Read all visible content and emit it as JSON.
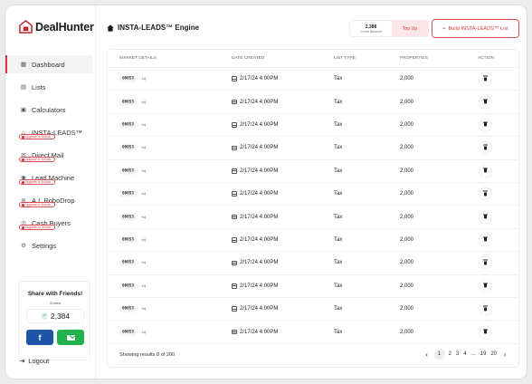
{
  "app": {
    "name": "DealHunter"
  },
  "sidebar": {
    "items": [
      {
        "label": "Dashboard",
        "icon": "grid-icon"
      },
      {
        "label": "Lists",
        "icon": "list-icon"
      },
      {
        "label": "Calculators",
        "icon": "calculator-icon"
      },
      {
        "label": "INSTA-LEADS™",
        "icon": "home-outline-icon",
        "locked": true
      },
      {
        "label": "Direct Mail",
        "icon": "mail-icon",
        "locked": true
      },
      {
        "label": "Lead Machine",
        "icon": "target-icon",
        "locked": true
      },
      {
        "label": "A.I. RoboDrop",
        "icon": "robot-icon",
        "locked": true
      },
      {
        "label": "Cash Buyers",
        "icon": "cash-icon",
        "locked": true
      },
      {
        "label": "Settings",
        "icon": "gear-icon"
      }
    ],
    "lock_badge": "Upgrade to Unlock",
    "logout": "Logout"
  },
  "share": {
    "title": "Share with Friends!",
    "subtitle": "Shares",
    "count": "2,384"
  },
  "header": {
    "title": "INSTA-LEADS™ Engine",
    "credit_value": "2,388",
    "credit_label": "Credit Balance",
    "topup_label": "Top Up",
    "build_label": "Build INSTA-LEADS™ List",
    "build_plus": "+"
  },
  "table": {
    "columns": [
      "MARKET DETAILS",
      "DATE CREATED",
      "LIST TYPE",
      "PROPERTIES",
      "ACTION"
    ],
    "rows": [
      {
        "zip": "06053",
        "more": "+4",
        "date": "2/17/24 4:00PM",
        "type": "Tax",
        "properties": "2,000"
      },
      {
        "zip": "06053",
        "more": "+4",
        "date": "2/17/24 4:00PM",
        "type": "Tax",
        "properties": "2,000"
      },
      {
        "zip": "06053",
        "more": "+4",
        "date": "2/17/24 4:00PM",
        "type": "Tax",
        "properties": "2,000"
      },
      {
        "zip": "06053",
        "more": "+4",
        "date": "2/17/24 4:00PM",
        "type": "Tax",
        "properties": "2,000"
      },
      {
        "zip": "06053",
        "more": "+4",
        "date": "2/17/24 4:00PM",
        "type": "Tax",
        "properties": "2,000"
      },
      {
        "zip": "06053",
        "more": "+4",
        "date": "2/17/24 4:00PM",
        "type": "Tax",
        "properties": "2,000"
      },
      {
        "zip": "06053",
        "more": "+4",
        "date": "2/17/24 4:00PM",
        "type": "Tax",
        "properties": "2,000"
      },
      {
        "zip": "06053",
        "more": "+4",
        "date": "2/17/24 4:00PM",
        "type": "Tax",
        "properties": "2,000"
      },
      {
        "zip": "06053",
        "more": "+4",
        "date": "2/17/24 4:00PM",
        "type": "Tax",
        "properties": "2,000"
      },
      {
        "zip": "06053",
        "more": "+4",
        "date": "2/17/24 4:00PM",
        "type": "Tax",
        "properties": "2,000"
      },
      {
        "zip": "06053",
        "more": "+4",
        "date": "2/17/24 4:00PM",
        "type": "Tax",
        "properties": "2,000"
      },
      {
        "zip": "06053",
        "more": "+4",
        "date": "2/17/24 4:00PM",
        "type": "Tax",
        "properties": "2,000"
      }
    ],
    "footer": "Showing results 8 of 200",
    "pagination": {
      "prev": "‹",
      "pages": [
        "1",
        "2",
        "3",
        "4",
        "...",
        "19",
        "20"
      ],
      "current": "1",
      "next": "›"
    }
  },
  "colors": {
    "accent": "#d9363e",
    "facebook": "#1f55a6",
    "email": "#23b14d"
  }
}
